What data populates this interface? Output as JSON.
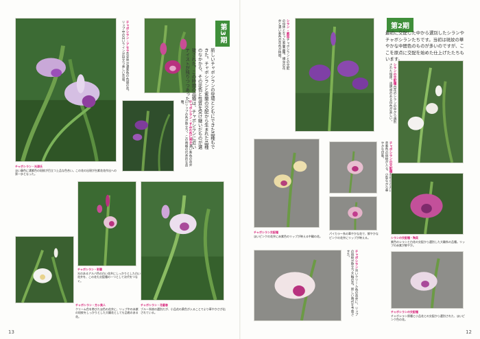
{
  "pages": {
    "left_number": "13",
    "right_number": "12"
  },
  "sections": {
    "third": {
      "label": "第3期",
      "intro": "新しいチャボシランの登場とともにできた品種もできた。チャボシランと紫蘭の交配から生まれた品種のなかから、その花色と性質を受け継いだものが選抜された。この時期の品種は、チャボシランに近いテイストが残りつつあった。"
    },
    "second": {
      "label": "第2期",
      "intro": "最初に交配した中から選別したシランやチャボシランたちです。当初は斑紋の華やかな中間色のものが多いのですが、ここを原点に交配を始めた仕上げたたちもいます。"
    }
  },
  "captions": {
    "c1": {
      "title": "チャボシラン・光源氏",
      "text": "淡い藤色に濃紫色の斑紋が目立つ上品な色合い。この花の出現が台紫花花作出への第一歩となった。"
    },
    "c2": {
      "title": "チャボシラン・アセラ",
      "text": "花全体が濃紫色の色調の花。リップ中の白いラインが目立つ美しい花容。"
    },
    "c3": {
      "title": "チャボシラン・すみれ色に咲き",
      "text": "濃い紫色の花弁にリップの色が際立つ。この時期の代表的な品種。"
    },
    "c4": {
      "title": "チャボシラン・彩雲",
      "text": "光のあるアルバ色の白い花弁にしっかりとした白い花弁を、この花も交配種の一つとして次代をつなぐ。"
    },
    "c5": {
      "title": "チャボシラン・方ヶ美人",
      "text": "クリーム色を帯びた淡色の花弁に、リップ中の赤紫の斑紋をしっかりとした大輪花としても品格のある花。"
    },
    "c6": {
      "title": "チャボシラン・花載巻",
      "text": "ブルー系統の選別だが、小品花の黄色が入ることでより華やかさが出されている。"
    },
    "c7": {
      "title": "シラン・紫笛",
      "text": "チャボシランとの交配の母体となった紫蘭品種。細身の花弁と濃い紫色の花色が特徴。"
    },
    "c8": {
      "title": "シランの交配種",
      "text": "白花のシランの中から選別された個体。透明感のある白色が美しい。"
    },
    "c9": {
      "title": "チャボシランの交配種",
      "text": "黄色の花弁に赤紫色の斑紋が入る。小型ながら華やかな印象。"
    },
    "c10": {
      "title": "チャボシラン交配種",
      "text": "淡いピンクの花弁に赤紫色のリップが映える中輪の花。"
    },
    "c11": {
      "title": "",
      "text": "パイカラー系の華やかな花で、鮮やかなピンクの花弁にリップが映える。"
    },
    "c12": {
      "title": "チャボシラン",
      "text": "淡いクリーム色の花弁に、リップの斑紋が際立つ大輪の花。新しい時代を予感させた。"
    },
    "c13": {
      "title": "シランの交配種・陶英",
      "text": "紫色のシランと白花の交配から選別した大輪系の品種。リップの赤紫が鮮やか。"
    },
    "c14": {
      "title": "チャボシランの交配種",
      "text": "チャボシラン原種と小品花との交配から選別された、淡いピンク色の花。"
    }
  },
  "colors": {
    "accent": "#d6247a",
    "period": "#3f8f3a",
    "leaf": "#4f8a3a",
    "leaf_dark": "#2e5a24",
    "flower_purple": "#9b4fb8",
    "flower_magenta": "#c23d8e",
    "flower_white": "#f4f2f0",
    "flower_yellow": "#e8d28c"
  }
}
